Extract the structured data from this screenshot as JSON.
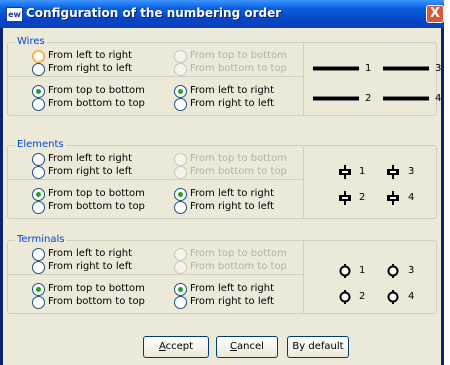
{
  "window": {
    "icon_text": "ew",
    "title": "Configuration of the numbering order",
    "close_label": "X"
  },
  "groups": [
    {
      "label": "Wires",
      "options": {
        "left_to_right": "From left to right",
        "right_to_left": "From right to left",
        "top_to_bottom": "From top to bottom",
        "bottom_to_top": "From bottom to top"
      },
      "preview_numbers": [
        "1",
        "3",
        "2",
        "4"
      ]
    },
    {
      "label": "Elements",
      "options": {
        "left_to_right": "From left to right",
        "right_to_left": "From right to left",
        "top_to_bottom": "From top to bottom",
        "bottom_to_top": "From bottom to top"
      },
      "preview_numbers": [
        "1",
        "3",
        "2",
        "4"
      ]
    },
    {
      "label": "Terminals",
      "options": {
        "left_to_right": "From left to right",
        "right_to_left": "From right to left",
        "top_to_bottom": "From top to bottom",
        "bottom_to_top": "From bottom to top"
      },
      "preview_numbers": [
        "1",
        "3",
        "2",
        "4"
      ]
    }
  ],
  "buttons": {
    "accept_u": "A",
    "accept_rest": "ccept",
    "cancel_u": "C",
    "cancel_rest": "ancel",
    "default": "By default"
  },
  "colors": {
    "group_label": "#0046d5",
    "title_bar": "#0a5fe0",
    "radio_checked": "#21a121"
  }
}
